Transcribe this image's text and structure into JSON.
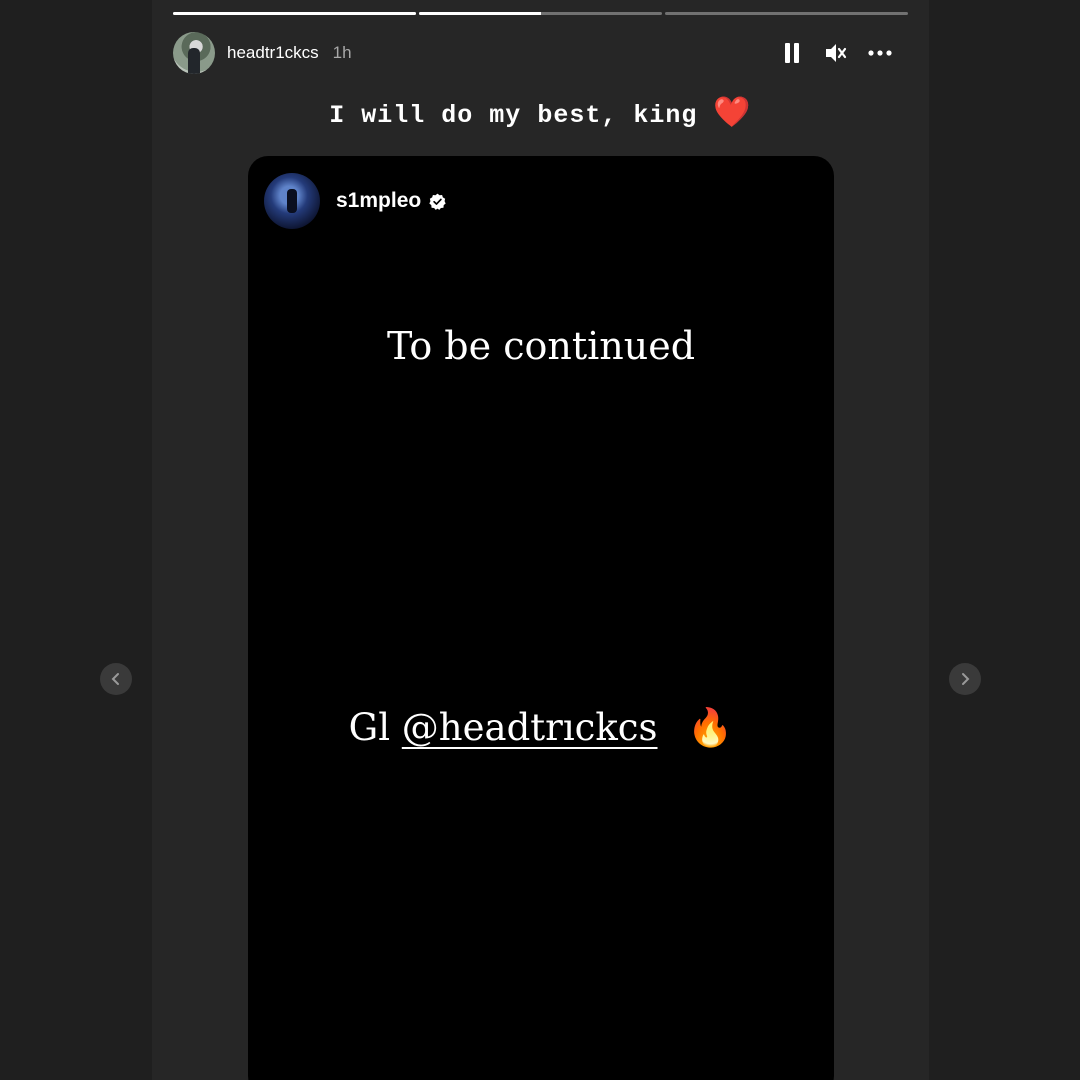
{
  "story": {
    "progress": [
      1.0,
      0.5,
      0.0
    ],
    "user": {
      "username": "headtr1ckcs",
      "time": "1h"
    },
    "controls": {
      "pause": "pause-icon",
      "mute": "muted-speaker-icon",
      "more": "more-horizontal-icon"
    },
    "caption": {
      "text": "I will do my best, king",
      "emoji": "❤️"
    }
  },
  "shared_post": {
    "username": "s1mpleo",
    "verified": true,
    "headline": "To be continued",
    "message_prefix": "Gl",
    "mention": "@headtrıckcs",
    "emoji": "🔥"
  },
  "nav": {
    "prev": "chevron-left-icon",
    "next": "chevron-right-icon"
  },
  "colors": {
    "background": "#1f1f1f",
    "story_bg": "#262626",
    "card_bg": "#000000",
    "heart": "#e0142b"
  }
}
